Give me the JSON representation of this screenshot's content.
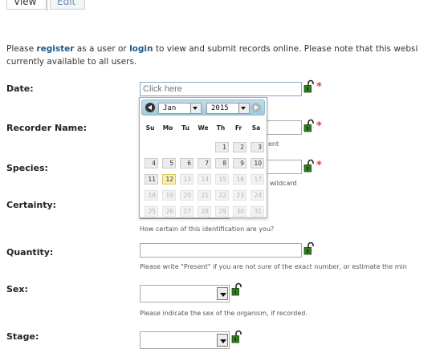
{
  "tabs": {
    "view": "View",
    "edit": "Edit"
  },
  "intro": {
    "line1_prefix": "Please ",
    "register": "register",
    "mid": " as a user or ",
    "login": "login",
    "line1_suffix": " to view and submit records online. Please note that this websi",
    "line2": "currently available to all users."
  },
  "fields": {
    "date": {
      "label": "Date:",
      "placeholder": "Click here"
    },
    "recorder": {
      "label": "Recorder Name:",
      "hint_fragment": "ent"
    },
    "species": {
      "label": "Species:",
      "hint_fragment": "wildcard"
    },
    "certainty": {
      "label": "Certainty:",
      "hint": "How certain of this identification are you?"
    },
    "quantity": {
      "label": "Quantity:",
      "hint": "Please write \"Present\" if you are not sure of the exact number, or estimate the min"
    },
    "sex": {
      "label": "Sex:",
      "hint": "Please indicate the sex of the organism, if recorded."
    },
    "stage": {
      "label": "Stage:"
    }
  },
  "required_marker": "*",
  "datepicker": {
    "month": "Jan",
    "year": "2015",
    "weekdays": [
      "Su",
      "Mo",
      "Tu",
      "We",
      "Th",
      "Fr",
      "Sa"
    ],
    "weeks": [
      [
        "",
        "",
        "",
        "",
        "1",
        "2",
        "3"
      ],
      [
        "4",
        "5",
        "6",
        "7",
        "8",
        "9",
        "10"
      ],
      [
        "11",
        "12",
        "13",
        "14",
        "15",
        "16",
        "17"
      ],
      [
        "18",
        "19",
        "20",
        "21",
        "22",
        "23",
        "24"
      ],
      [
        "25",
        "26",
        "27",
        "28",
        "29",
        "30",
        "31"
      ]
    ],
    "today": "12",
    "last_enabled_day": 12
  },
  "colors": {
    "link": "#1e5a8f",
    "required": "#e23b3b",
    "lock": "#2f7d1e",
    "today": "#fbeeb0"
  },
  "icons": {
    "lock": "unlocked-padlock-icon"
  }
}
